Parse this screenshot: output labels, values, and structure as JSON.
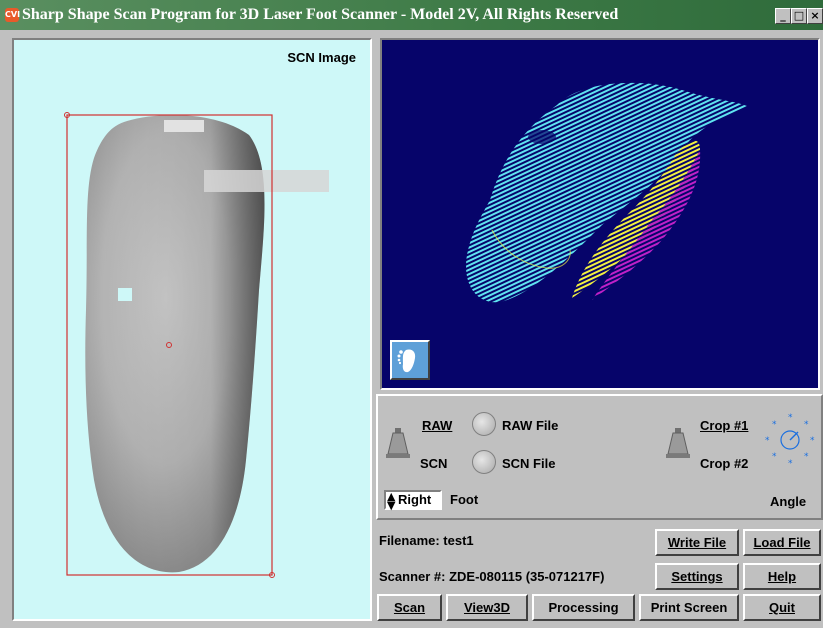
{
  "window": {
    "title": "Sharp Shape Scan Program for 3D Laser Foot Scanner - Model 2V, All Rights Reserved",
    "icon_text": "CVI",
    "minimize": "_",
    "maximize": "□",
    "close": "×"
  },
  "scn_image": {
    "label": "SCN Image"
  },
  "controls": {
    "raw_label": "RAW",
    "scn_label": "SCN",
    "raw_file_label": "RAW File",
    "scn_file_label": "SCN File",
    "crop1_label": "Crop #1",
    "crop2_label": "Crop #2",
    "angle_label": "Angle",
    "side_value": "Right",
    "foot_label": "Foot"
  },
  "info": {
    "filename": "Filename: test1",
    "scanner": "Scanner #:  ZDE-080115 (35-071217F)"
  },
  "buttons": {
    "write_file": "Write File",
    "load_file": "Load File",
    "settings": "Settings",
    "help": "Help",
    "scan": "Scan",
    "view3d": "View3D",
    "processing": "Processing",
    "print_screen": "Print Screen",
    "quit": "Quit"
  },
  "colors": {
    "title_bar": "#3d7a46",
    "scn_background": "#cef8f8",
    "view3d_background": "#06046a",
    "crop_rect": "#d03030",
    "scan_cyan": "#5fe3f0",
    "scan_yellow": "#f2f040",
    "scan_magenta": "#c020c8"
  },
  "icons": [
    "app-cvi-icon",
    "foot-icon",
    "bell-toggle-icon",
    "angle-dial-icon",
    "spin-arrows-icon"
  ]
}
